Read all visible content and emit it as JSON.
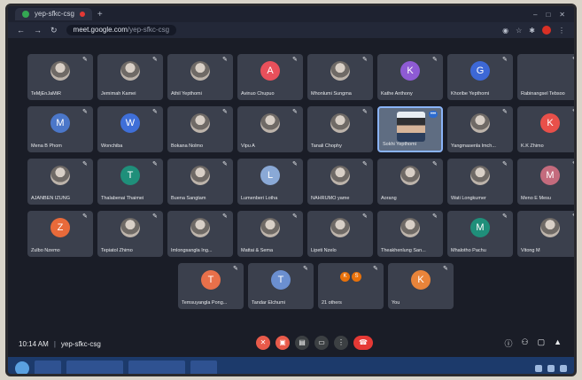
{
  "browser": {
    "tab_title": "yep-sfkc-csg",
    "new_tab": "+",
    "url_host": "meet.google.com",
    "url_path": "/yep-sfkc-csg"
  },
  "participants": [
    {
      "name": "TeMjEnJaMiR",
      "initial": "",
      "color": "#3c4043",
      "kind": "photo"
    },
    {
      "name": "Jemimah Kamei",
      "initial": "",
      "color": "#3c4043",
      "kind": "photo"
    },
    {
      "name": "Athil Yepthomi",
      "initial": "",
      "color": "#3c4043",
      "kind": "photo"
    },
    {
      "name": "Avinuo Chupuo",
      "initial": "A",
      "color": "#e8505b",
      "kind": "initial"
    },
    {
      "name": "Mhonlumi Sungma",
      "initial": "",
      "color": "#3c4043",
      "kind": "photo"
    },
    {
      "name": "Kathe Anthony",
      "initial": "K",
      "color": "#8e5bd4",
      "kind": "initial"
    },
    {
      "name": "Khoribe Yepthomi",
      "initial": "G",
      "color": "#3d68d6",
      "kind": "initial"
    },
    {
      "name": "Rabinangsel Tebsoo",
      "initial": "",
      "color": "#3c4043",
      "kind": "none"
    },
    {
      "name": "Mena B Phom",
      "initial": "M",
      "color": "#4b77c9",
      "kind": "initial"
    },
    {
      "name": "Wonchiba",
      "initial": "W",
      "color": "#3f6fd8",
      "kind": "initial"
    },
    {
      "name": "Bokana Nolmo",
      "initial": "",
      "color": "#3c4043",
      "kind": "photo"
    },
    {
      "name": "Vipu A",
      "initial": "",
      "color": "#3c4043",
      "kind": "photo"
    },
    {
      "name": "Tanali Chophy",
      "initial": "",
      "color": "#3c4043",
      "kind": "photo"
    },
    {
      "name": "Sokhi Yepthomi",
      "initial": "",
      "color": "#3c4043",
      "kind": "active"
    },
    {
      "name": "Yangmasenla lmch...",
      "initial": "",
      "color": "#3c4043",
      "kind": "photo"
    },
    {
      "name": "K.K Zhimo",
      "initial": "K",
      "color": "#e8504a",
      "kind": "initial"
    },
    {
      "name": "AJANBEN IZUNG",
      "initial": "",
      "color": "#3c4043",
      "kind": "photo"
    },
    {
      "name": "Thalabenai Thaimei",
      "initial": "T",
      "color": "#1f8f7a",
      "kind": "initial"
    },
    {
      "name": "Buena Sangtam",
      "initial": "",
      "color": "#3c4043",
      "kind": "photo"
    },
    {
      "name": "Lumenberi Lotha",
      "initial": "L",
      "color": "#8aa9d6",
      "kind": "initial"
    },
    {
      "name": "NAHRUMO yame",
      "initial": "",
      "color": "#3c4043",
      "kind": "photo"
    },
    {
      "name": "Aorang",
      "initial": "",
      "color": "#3c4043",
      "kind": "photo"
    },
    {
      "name": "Wati Longkumer",
      "initial": "",
      "color": "#3c4043",
      "kind": "photo"
    },
    {
      "name": "Meno E Mesu",
      "initial": "M",
      "color": "#c46b7d",
      "kind": "initial"
    },
    {
      "name": "Zulbo Nzemo",
      "initial": "Z",
      "color": "#e86a3a",
      "kind": "initial"
    },
    {
      "name": "Tepiatol Zhimo",
      "initial": "",
      "color": "#3c4043",
      "kind": "photo"
    },
    {
      "name": "Imlongsangla Ing...",
      "initial": "",
      "color": "#3c4043",
      "kind": "photo"
    },
    {
      "name": "Mattai & Sema",
      "initial": "",
      "color": "#3c4043",
      "kind": "photo"
    },
    {
      "name": "Lipeti Nzelo",
      "initial": "",
      "color": "#3c4043",
      "kind": "photo"
    },
    {
      "name": "Theakhenlung San...",
      "initial": "",
      "color": "#3c4043",
      "kind": "photo"
    },
    {
      "name": "Mhalotho Pachu",
      "initial": "M",
      "color": "#1f8f7a",
      "kind": "initial"
    },
    {
      "name": "Vitong M",
      "initial": "",
      "color": "#3c4043",
      "kind": "photo"
    },
    {
      "name": "Temsuyangla Pong...",
      "initial": "T",
      "color": "#e8704a",
      "kind": "initial"
    },
    {
      "name": "Tandar Elchumi",
      "initial": "T",
      "color": "#6b8fd0",
      "kind": "initial"
    },
    {
      "name": "21 others",
      "initial": "",
      "color": "#3c4043",
      "kind": "others"
    },
    {
      "name": "You",
      "initial": "K",
      "color": "#e8843a",
      "kind": "initial"
    }
  ],
  "others_avatars": [
    "K",
    "S"
  ],
  "bottom": {
    "time": "10:14 AM",
    "meeting_code": "yep-sfkc-csg"
  }
}
